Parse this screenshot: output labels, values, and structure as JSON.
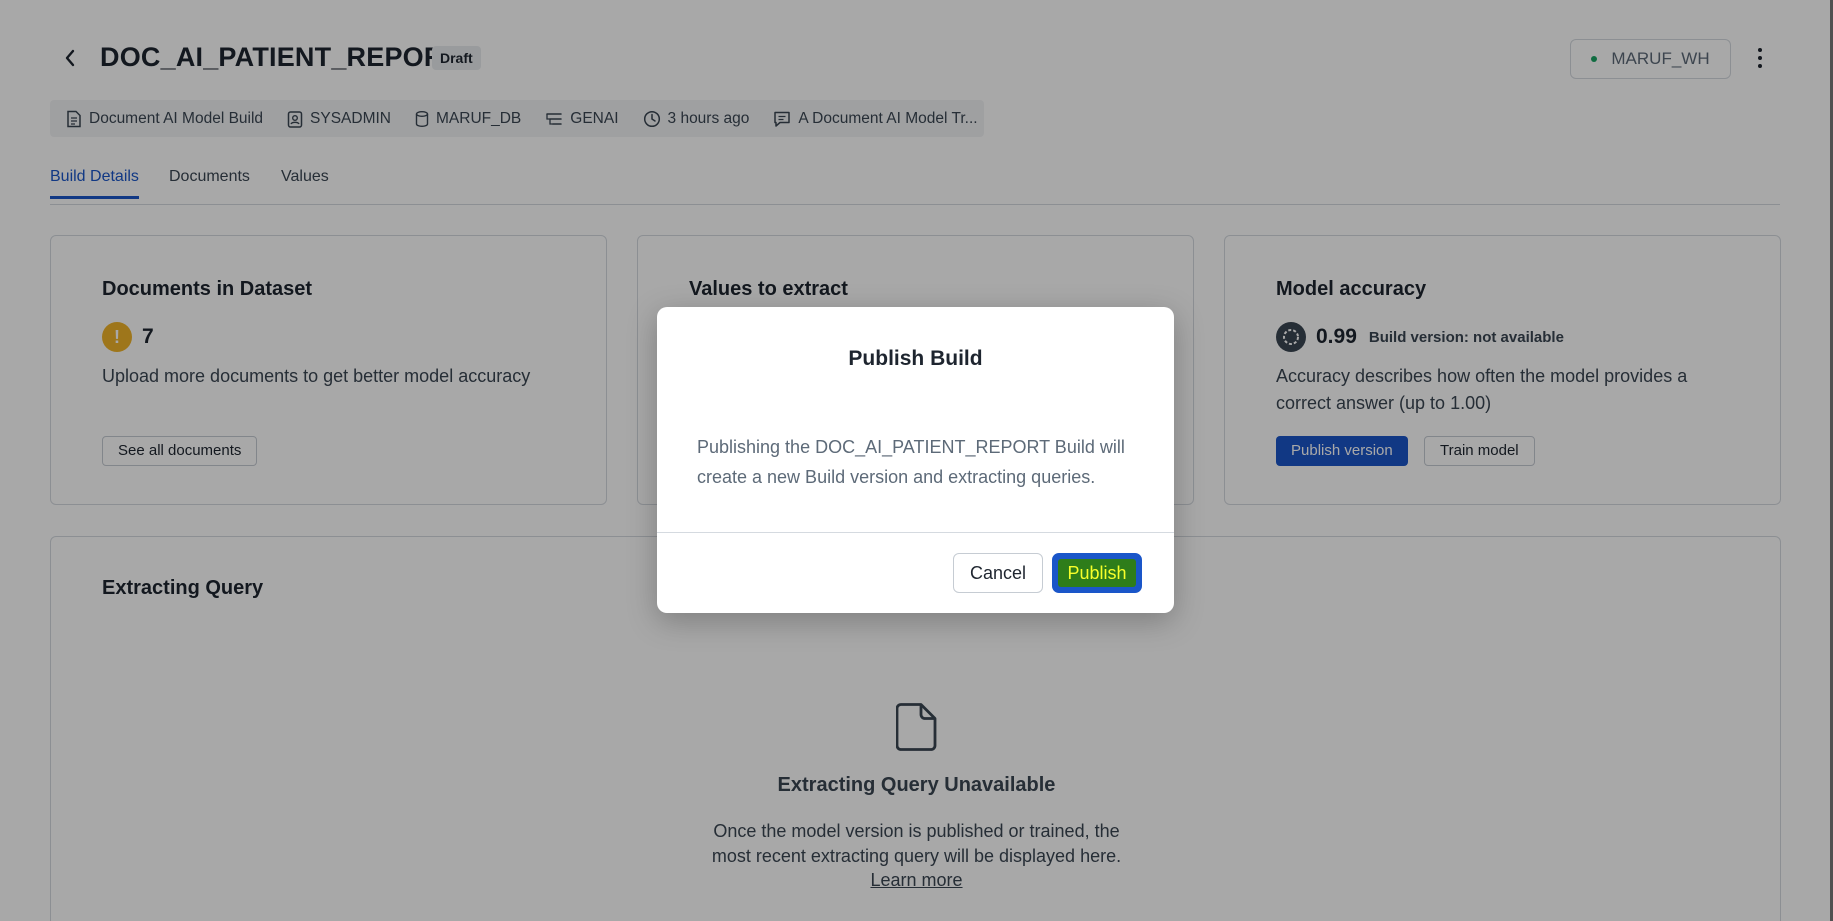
{
  "header": {
    "title": "DOC_AI_PATIENT_REPORT",
    "status_badge": "Draft",
    "warehouse": "MARUF_WH"
  },
  "meta": {
    "type": "Document AI Model Build",
    "role": "SYSADMIN",
    "database": "MARUF_DB",
    "schema": "GENAI",
    "updated": "3 hours ago",
    "comment": "A Document AI Model Tr..."
  },
  "tabs": [
    {
      "label": "Build Details",
      "active": true
    },
    {
      "label": "Documents",
      "active": false
    },
    {
      "label": "Values",
      "active": false
    }
  ],
  "cards": {
    "documents": {
      "title": "Documents in Dataset",
      "count": "7",
      "description": "Upload more documents to get better model accuracy",
      "button": "See all documents"
    },
    "values": {
      "title": "Values to extract"
    },
    "accuracy": {
      "title": "Model accuracy",
      "value": "0.99",
      "build_version": "Build version: not available",
      "description": "Accuracy describes how often the model provides a correct answer (up to 1.00)",
      "publish_button": "Publish version",
      "train_button": "Train model"
    }
  },
  "extracting_query": {
    "title": "Extracting Query",
    "empty_title": "Extracting Query Unavailable",
    "empty_text": "Once the model version is published or trained, the most recent extracting query will be displayed here.",
    "learn_more": "Learn more"
  },
  "modal": {
    "title": "Publish Build",
    "body": "Publishing the DOC_AI_PATIENT_REPORT Build will create a new Build version and extracting queries.",
    "cancel": "Cancel",
    "publish": "Publish"
  },
  "colors": {
    "accent": "#1a56c9",
    "warning": "#f0b429",
    "online": "#19a463"
  }
}
